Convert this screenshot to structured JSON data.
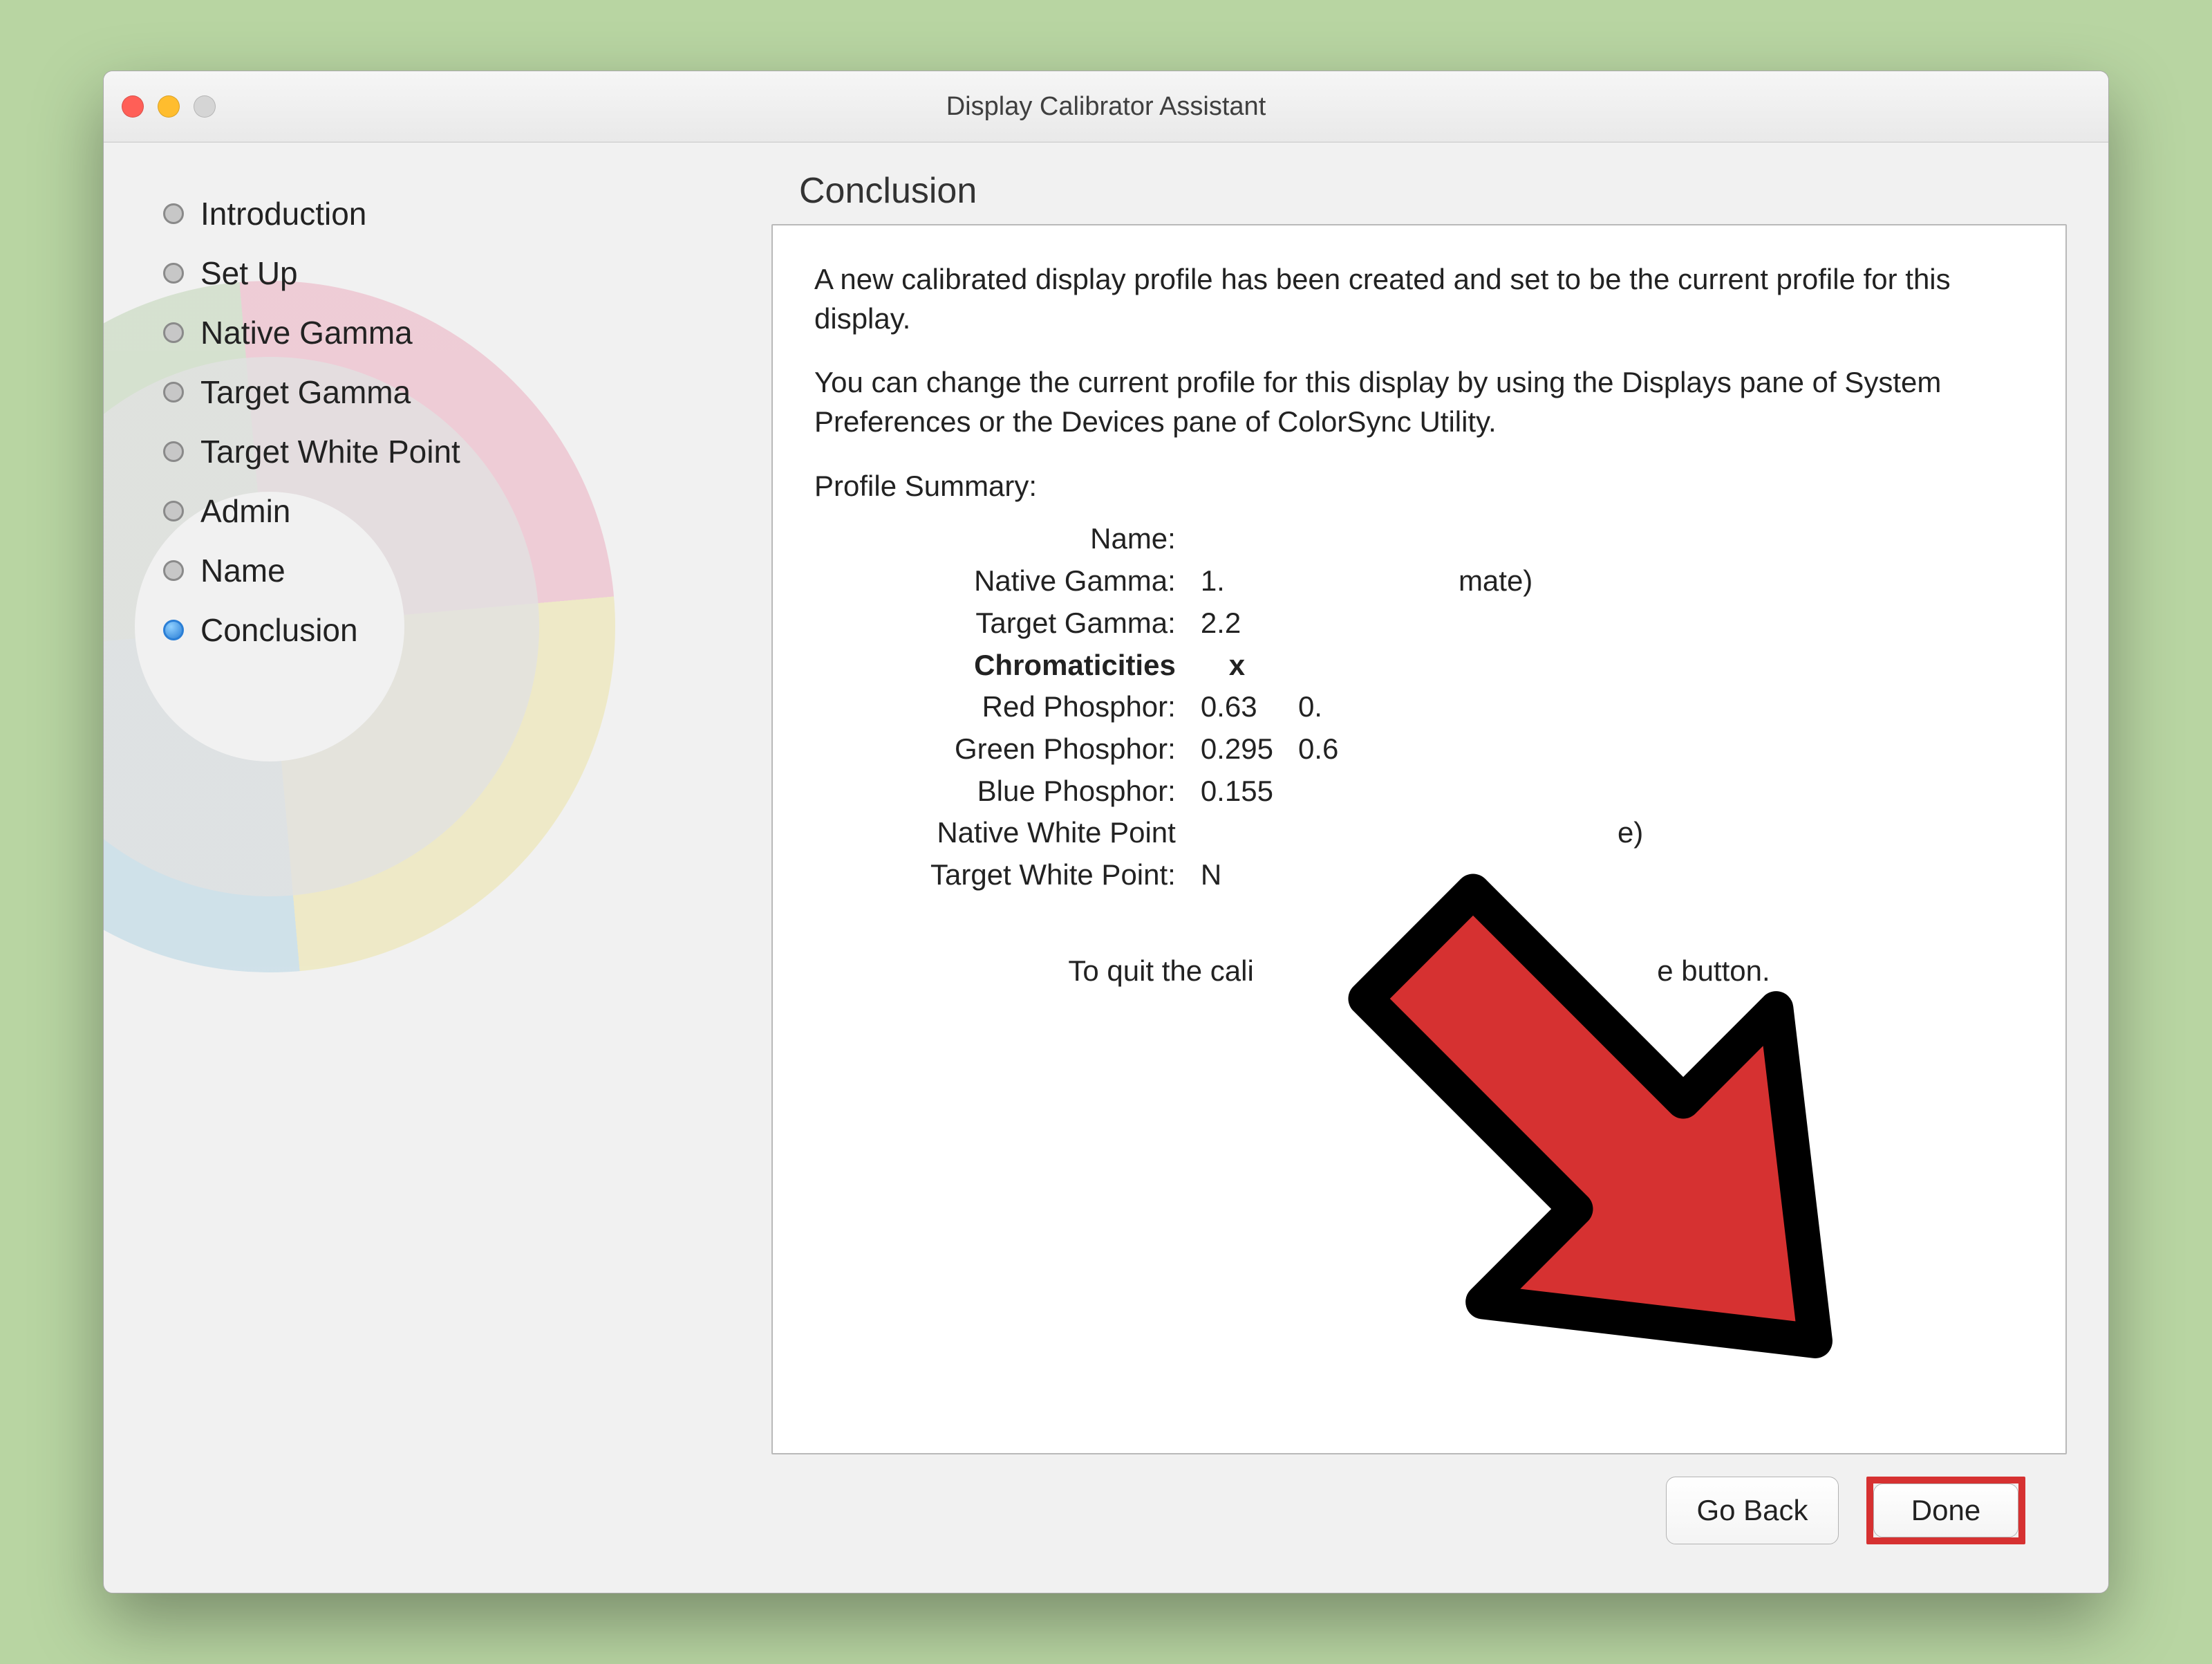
{
  "window": {
    "title": "Display Calibrator Assistant",
    "section_heading": "Conclusion"
  },
  "sidebar": {
    "steps": [
      {
        "label": "Introduction",
        "active": false
      },
      {
        "label": "Set Up",
        "active": false
      },
      {
        "label": "Native Gamma",
        "active": false
      },
      {
        "label": "Target Gamma",
        "active": false
      },
      {
        "label": "Target White Point",
        "active": false
      },
      {
        "label": "Admin",
        "active": false
      },
      {
        "label": "Name",
        "active": false
      },
      {
        "label": "Conclusion",
        "active": true
      }
    ]
  },
  "content": {
    "intro_1": "A new calibrated display profile has been created and set to be the current profile for this display.",
    "intro_2": "You can change the current profile for this display by using the Displays pane of System Preferences or the Devices pane of ColorSync Utility.",
    "summary_heading": "Profile Summary:",
    "summary_rows": {
      "name": {
        "k": "Name:",
        "v": ""
      },
      "native_gamma": {
        "k": "Native Gamma:",
        "v": "1.",
        "note": "mate)"
      },
      "target_gamma": {
        "k": "Target Gamma:",
        "v": "2.2"
      },
      "chroma_header": {
        "k": "Chromaticities",
        "x": "x",
        "y": ""
      },
      "red": {
        "k": "Red Phosphor:",
        "x": "0.63",
        "y": "0."
      },
      "green": {
        "k": "Green Phosphor:",
        "x": "0.295",
        "y": "0.6"
      },
      "blue": {
        "k": "Blue Phosphor:",
        "x": "0.155",
        "y": ""
      },
      "native_wp": {
        "k": "Native White Point",
        "v": "",
        "note": "e)"
      },
      "target_wp": {
        "k": "Target White Point:",
        "v": "N"
      }
    },
    "quit_text_left": "To quit the cali",
    "quit_text_right": "e button."
  },
  "footer": {
    "back_label": "Go Back",
    "done_label": "Done"
  },
  "annotation": {
    "highlight_target": "done-button"
  }
}
